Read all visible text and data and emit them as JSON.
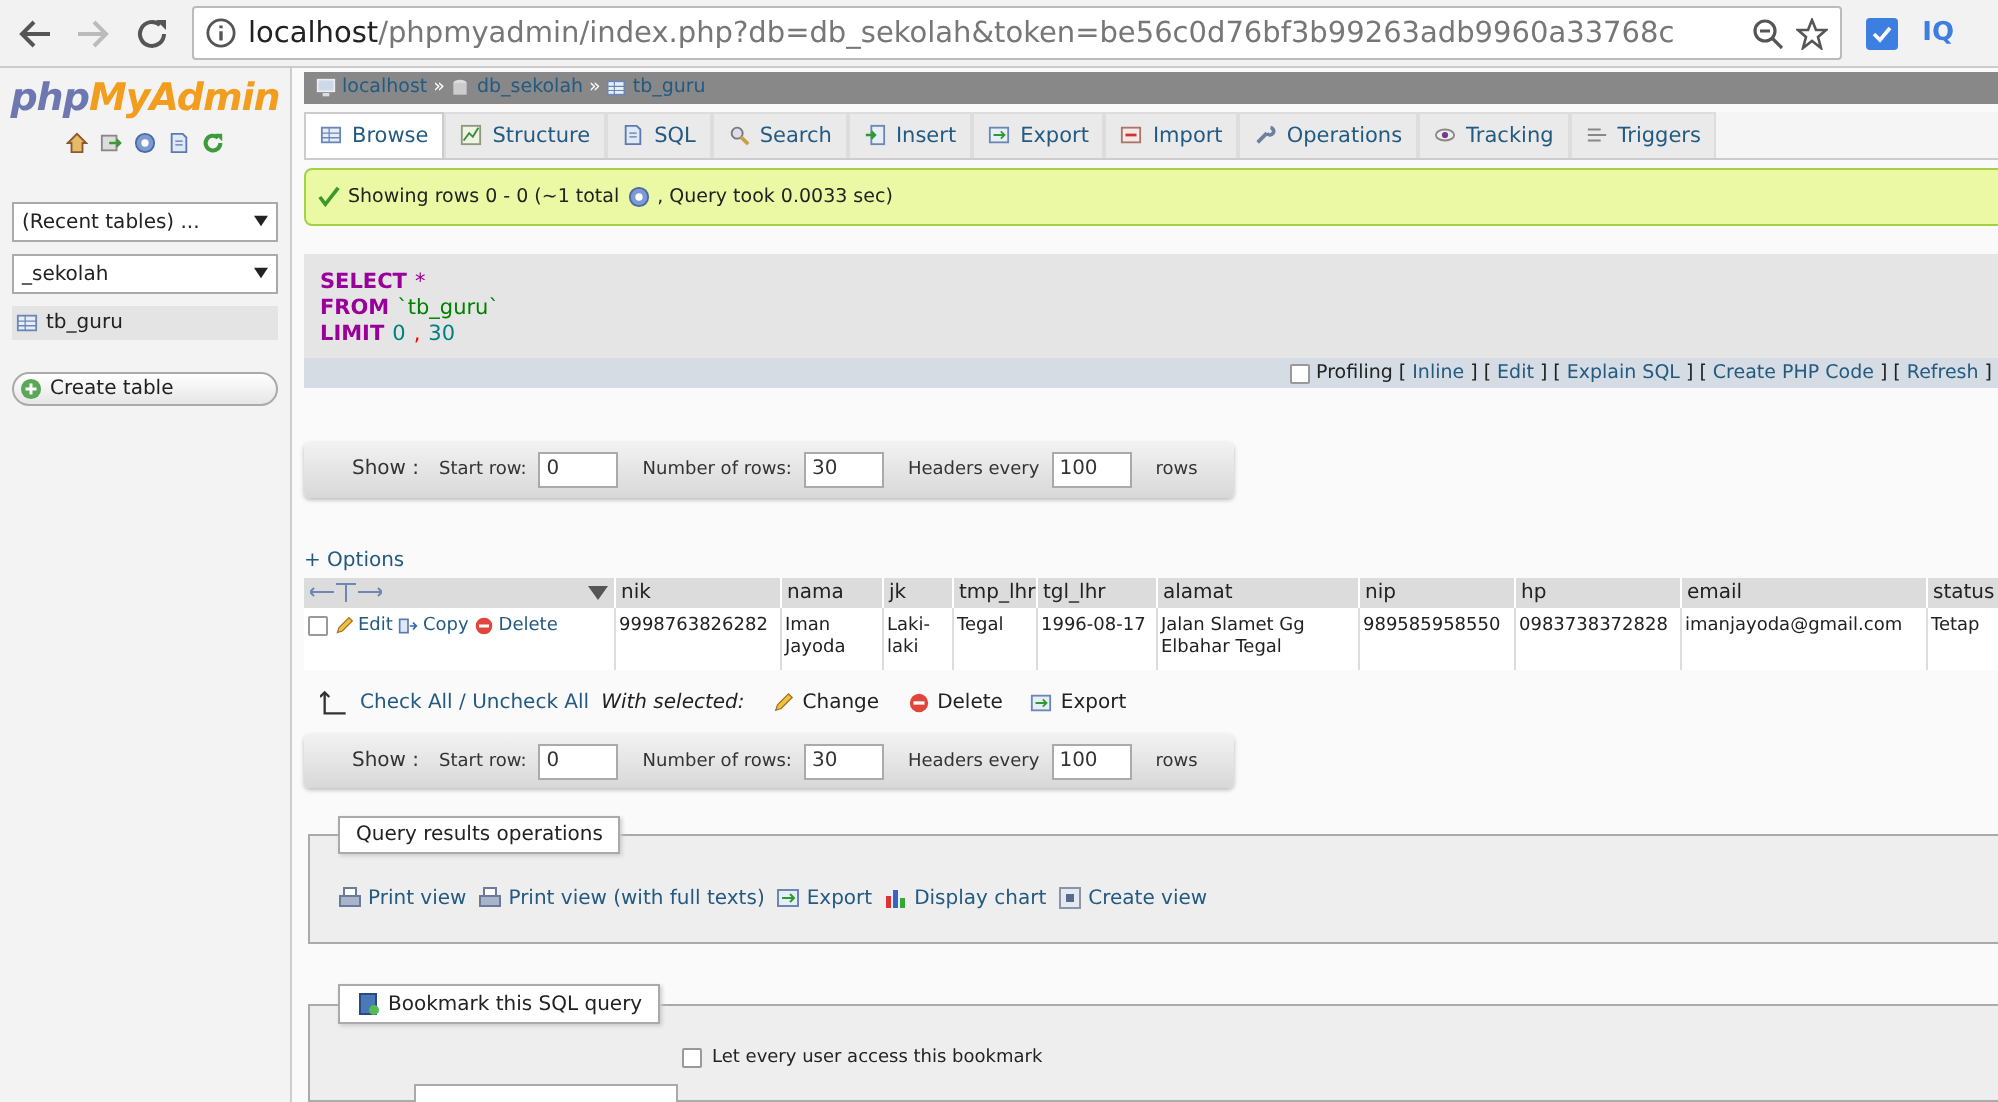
{
  "browser": {
    "url_host": "localhost",
    "url_path": "/phpmyadmin/index.php?db=db_sekolah&token=be56c0d76bf3b99263adb9960a33768c",
    "extension_label": "IQ"
  },
  "sidebar": {
    "logo_prefix": "php",
    "logo_main": "MyAdmin",
    "recent_tables": "(Recent tables) ...",
    "database": "_sekolah",
    "tables": [
      {
        "name": "tb_guru",
        "selected": true
      }
    ],
    "create_table": "Create table"
  },
  "breadcrumb": {
    "separator": "»",
    "items": [
      {
        "label": "localhost",
        "kind": "server"
      },
      {
        "label": "db_sekolah",
        "kind": "database"
      },
      {
        "label": "tb_guru",
        "kind": "table"
      }
    ]
  },
  "tabs": [
    {
      "label": "Browse",
      "selected": true
    },
    {
      "label": "Structure",
      "selected": false
    },
    {
      "label": "SQL",
      "selected": false
    },
    {
      "label": "Search",
      "selected": false
    },
    {
      "label": "Insert",
      "selected": false
    },
    {
      "label": "Export",
      "selected": false
    },
    {
      "label": "Import",
      "selected": false
    },
    {
      "label": "Operations",
      "selected": false
    },
    {
      "label": "Tracking",
      "selected": false
    },
    {
      "label": "Triggers",
      "selected": false
    }
  ],
  "message": {
    "text": "Showing rows 0 - 0 (~1 total",
    "tail": ", Query took 0.0033 sec)"
  },
  "sql": {
    "lines": [
      [
        {
          "text": "SELECT",
          "kind": "keyword"
        },
        {
          "text": "*",
          "kind": "operator"
        }
      ],
      [
        {
          "text": "FROM",
          "kind": "keyword"
        },
        {
          "text": "`tb_guru`",
          "kind": "identifier"
        }
      ],
      [
        {
          "text": "LIMIT",
          "kind": "keyword"
        },
        {
          "text": "0",
          "kind": "number"
        },
        {
          "text": ",",
          "kind": "punct"
        },
        {
          "text": "30",
          "kind": "number"
        }
      ]
    ]
  },
  "profiling": {
    "label": "Profiling",
    "checked": false,
    "open": "[",
    "close": "]",
    "links": [
      "Inline",
      "Edit",
      "Explain SQL",
      "Create PHP Code",
      "Refresh"
    ]
  },
  "navigation": [
    {
      "show": "Show :",
      "start_label": "Start row:",
      "start_value": "0",
      "rows_label": "Number of rows:",
      "rows_value": "30",
      "headers_label": "Headers every",
      "headers_value": "100",
      "tail": "rows"
    },
    {
      "show": "Show :",
      "start_label": "Start row:",
      "start_value": "0",
      "rows_label": "Number of rows:",
      "rows_value": "30",
      "headers_label": "Headers every",
      "headers_value": "100",
      "tail": "rows"
    }
  ],
  "options": "+ Options",
  "table": {
    "columns": [
      "nik",
      "nama",
      "jk",
      "tmp_lhr",
      "tgl_lhr",
      "alamat",
      "nip",
      "hp",
      "email",
      "status"
    ],
    "rows": [
      {
        "checked": false,
        "actions": [
          "Edit",
          "Copy",
          "Delete"
        ],
        "cells": [
          "9998763826282",
          "Iman Jayoda",
          "Laki-laki",
          "Tegal",
          "1996-08-17",
          "Jalan Slamet Gg Elbahar Tegal",
          "989585958550",
          "0983738372828",
          "imanjayoda@gmail.com",
          "Tetap"
        ]
      }
    ]
  },
  "with_selected": {
    "check_all": "Check All / Uncheck All",
    "label": "With selected:",
    "actions": [
      "Change",
      "Delete",
      "Export"
    ]
  },
  "results_operations": {
    "legend": "Query results operations",
    "links": [
      "Print view",
      "Print view (with full texts)",
      "Export",
      "Display chart",
      "Create view"
    ]
  },
  "bookmark": {
    "legend": "Bookmark this SQL query",
    "share_label": "Let every user access this bookmark",
    "share_checked": false
  }
}
